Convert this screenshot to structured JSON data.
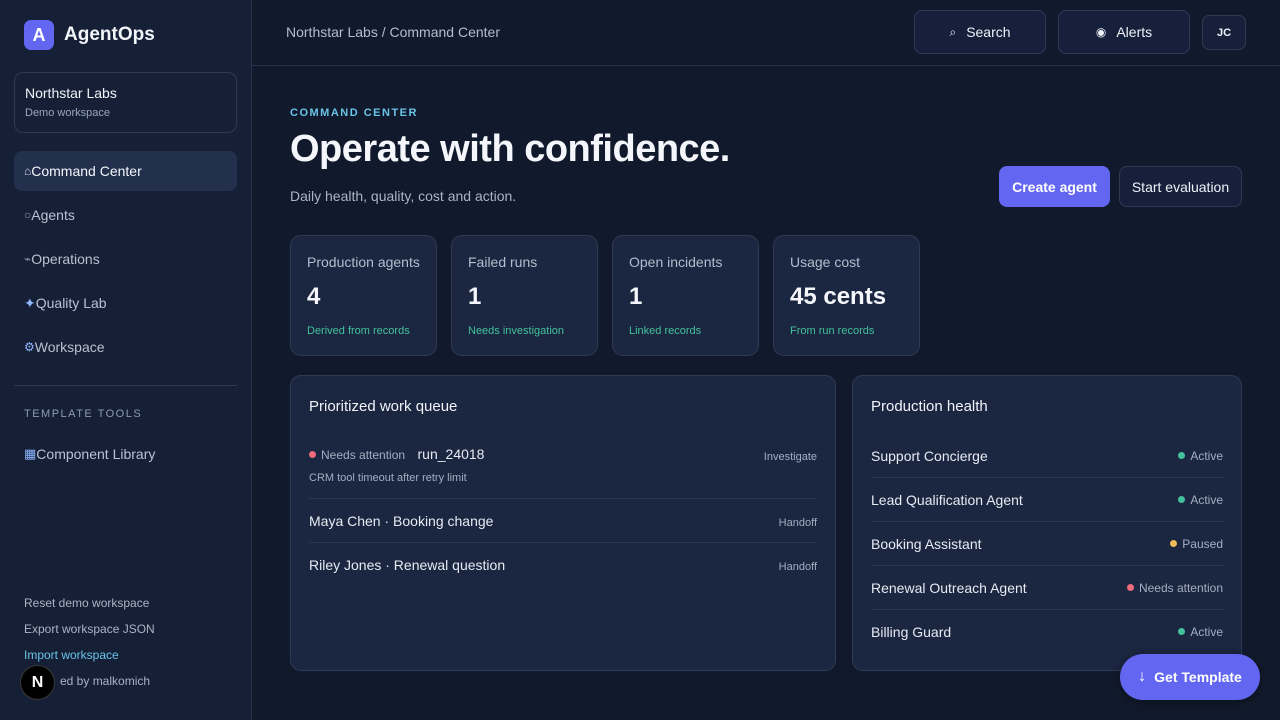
{
  "brand": {
    "logo_letter": "A",
    "name": "AgentOps"
  },
  "workspace": {
    "name": "Northstar Labs",
    "subtitle": "Demo workspace"
  },
  "nav": [
    {
      "icon": "⌂",
      "icon_name": "home-icon",
      "label": "Command Center",
      "active": true
    },
    {
      "icon": "○",
      "icon_name": "circle-icon",
      "label": "Agents"
    },
    {
      "icon": "⌁",
      "icon_name": "pulse-icon",
      "label": "Operations"
    },
    {
      "icon": "✦",
      "icon_name": "sparkle-icon",
      "label": "Quality Lab"
    },
    {
      "icon": "⚙",
      "icon_name": "gear-icon",
      "label": "Workspace"
    }
  ],
  "tools": {
    "heading": "TEMPLATE TOOLS",
    "icon": "▦",
    "icon_name": "grid-icon",
    "item": "Component Library"
  },
  "footer": {
    "reset": "Reset demo workspace",
    "export": "Export workspace JSON",
    "import": "Import workspace",
    "credit": "ed by malkomich",
    "badge": "N"
  },
  "topbar": {
    "breadcrumb": "Northstar Labs / Command Center",
    "search_icon": "⌕",
    "search_label": "Search",
    "alerts_icon": "◉",
    "alerts_label": "Alerts",
    "avatar": "JC"
  },
  "header": {
    "eyebrow": "COMMAND CENTER",
    "title": "Operate with confidence.",
    "subtitle": "Daily health, quality, cost and action.",
    "primary_action": "Create agent",
    "secondary_action": "Start evaluation"
  },
  "metrics": [
    {
      "label": "Production agents",
      "value": "4",
      "note": "Derived from records"
    },
    {
      "label": "Failed runs",
      "value": "1",
      "note": "Needs investigation"
    },
    {
      "label": "Open incidents",
      "value": "1",
      "note": "Linked records"
    },
    {
      "label": "Usage cost",
      "value": "45 cents",
      "note": "From run records"
    }
  ],
  "queue": {
    "title": "Prioritized work queue",
    "items": [
      {
        "status": "Needs attention",
        "title": "run_24018",
        "description": "CRM tool timeout after retry limit",
        "action": "Investigate"
      },
      {
        "title": "Maya Chen · Booking change",
        "action": "Handoff"
      },
      {
        "title": "Riley Jones · Renewal question",
        "action": "Handoff"
      }
    ]
  },
  "health": {
    "title": "Production health",
    "items": [
      {
        "name": "Support Concierge",
        "status": "Active"
      },
      {
        "name": "Lead Qualification Agent",
        "status": "Active"
      },
      {
        "name": "Booking Assistant",
        "status": "Paused"
      },
      {
        "name": "Renewal Outreach Agent",
        "status": "Needs attention"
      },
      {
        "name": "Billing Guard",
        "status": "Active"
      }
    ]
  },
  "colors": {
    "accent": "#6366f1",
    "active": "#43c29a",
    "paused": "#f0b95a",
    "attention": "#ee6b7b",
    "eyebrow": "#6ac3e8"
  },
  "fab": {
    "icon": "↓",
    "label": "Get Template"
  }
}
